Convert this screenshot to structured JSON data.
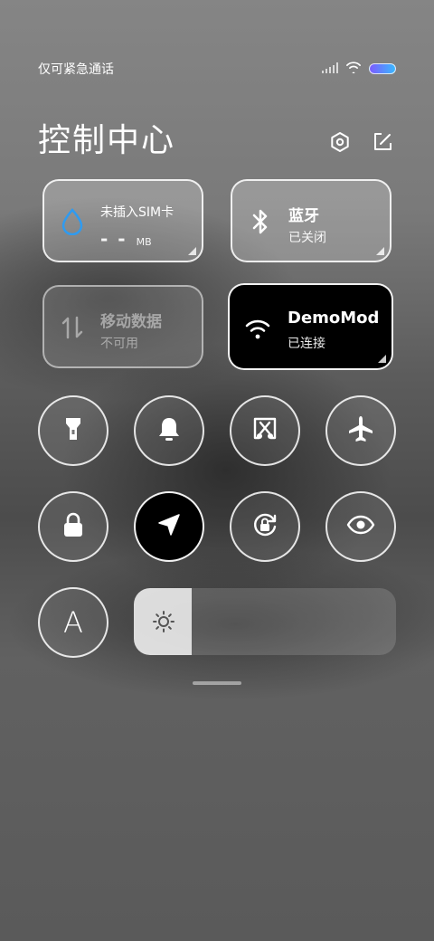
{
  "status_bar": {
    "carrier": "仅可紧急通话",
    "signal_icon": "signal-bars-icon",
    "wifi_icon": "wifi-icon",
    "battery_icon": "battery-icon"
  },
  "header": {
    "title": "控制中心",
    "settings_icon": "settings-icon",
    "edit_icon": "edit-icon"
  },
  "tiles": {
    "data_usage": {
      "title": "未插入SIM卡",
      "value": "- -",
      "unit": "MB",
      "icon": "water-drop-icon",
      "icon_color": "#2f9bf0"
    },
    "bluetooth": {
      "title": "蓝牙",
      "status": "已关闭",
      "icon": "bluetooth-icon"
    },
    "mobile_data": {
      "title": "移动数据",
      "status": "不可用",
      "icon": "mobile-data-icon"
    },
    "wifi": {
      "title": "DemoMod",
      "status": "已连接",
      "icon": "wifi-icon"
    }
  },
  "toggles": [
    {
      "name": "flashlight",
      "icon": "flashlight-icon",
      "active": false
    },
    {
      "name": "notification",
      "icon": "bell-icon",
      "active": false
    },
    {
      "name": "screenshot",
      "icon": "screenshot-scissors-icon",
      "active": false
    },
    {
      "name": "airplane-mode",
      "icon": "airplane-icon",
      "active": false
    },
    {
      "name": "lock-screen",
      "icon": "lock-icon",
      "active": false
    },
    {
      "name": "location",
      "icon": "location-arrow-icon",
      "active": true
    },
    {
      "name": "rotation-lock",
      "icon": "rotation-lock-icon",
      "active": false
    },
    {
      "name": "eye-comfort",
      "icon": "eye-icon",
      "active": false
    },
    {
      "name": "auto-brightness",
      "icon": "font-a-icon",
      "active": false,
      "label": "A"
    }
  ],
  "brightness": {
    "level": 0.22,
    "icon": "sun-icon"
  }
}
